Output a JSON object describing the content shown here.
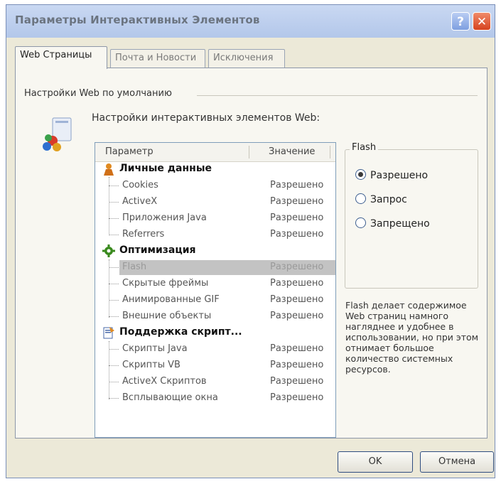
{
  "window": {
    "title": "Параметры Интерактивных Элементов",
    "help_glyph": "?",
    "close_glyph": "✕"
  },
  "tabs": [
    {
      "label": "Web Страницы",
      "active": true
    },
    {
      "label": "Почта и Новости",
      "active": false
    },
    {
      "label": "Исключения",
      "active": false
    }
  ],
  "panel": {
    "group_label": "Настройки Web по умолчанию",
    "sub_label": "Настройки интерактивных элементов Web:"
  },
  "tree": {
    "col_param": "Параметр",
    "col_value": "Значение",
    "groups": [
      {
        "name": "Личные данные",
        "icon": "person-icon",
        "items": [
          {
            "name": "Cookies",
            "value": "Разрешено"
          },
          {
            "name": "ActiveX",
            "value": "Разрешено"
          },
          {
            "name": "Приложения Java",
            "value": "Разрешено"
          },
          {
            "name": "Referrers",
            "value": "Разрешено"
          }
        ]
      },
      {
        "name": "Оптимизация",
        "icon": "gear-icon",
        "items": [
          {
            "name": "Flash",
            "value": "Разрешено",
            "selected": true
          },
          {
            "name": "Скрытые фреймы",
            "value": "Разрешено"
          },
          {
            "name": "Анимированные GIF",
            "value": "Разрешено"
          },
          {
            "name": "Внешние объекты",
            "value": "Разрешено"
          }
        ]
      },
      {
        "name": "Поддержка скрипт...",
        "icon": "script-icon",
        "items": [
          {
            "name": "Скрипты Java",
            "value": "Разрешено"
          },
          {
            "name": "Скрипты VB",
            "value": "Разрешено"
          },
          {
            "name": "ActiveX Скриптов",
            "value": "Разрешено"
          },
          {
            "name": "Всплывающие окна",
            "value": "Разрешено"
          }
        ]
      }
    ]
  },
  "flash": {
    "title": "Flash",
    "options": [
      {
        "label": "Разрешено",
        "checked": true
      },
      {
        "label": "Запрос",
        "checked": false
      },
      {
        "label": "Запрещено",
        "checked": false
      }
    ],
    "description": "Flash делает содержимое Web страниц намного нагляднее и удобнее в использовании, но при этом отнимает большое количество системных ресурсов."
  },
  "buttons": {
    "ok": "OK",
    "cancel": "Отмена"
  },
  "colors": {
    "titlebar": "#b3c7ea",
    "dialog_bg": "#ece9d8",
    "selection": "#c3c3c3",
    "close_button": "#d6431f"
  }
}
